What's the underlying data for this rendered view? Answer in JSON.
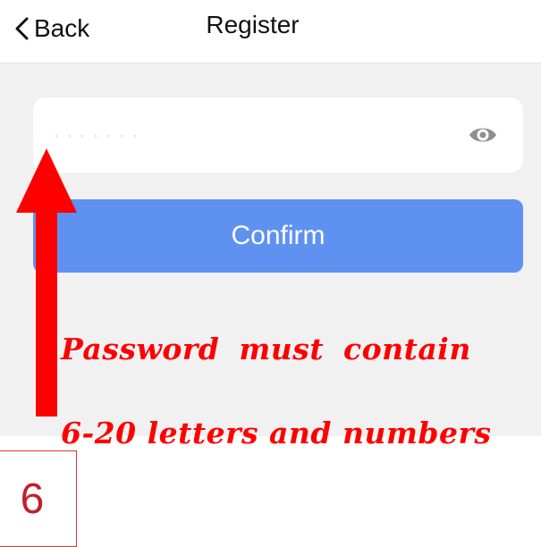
{
  "nav": {
    "back_label": "Back",
    "title": "Register"
  },
  "form": {
    "password_value": "",
    "password_placeholder": "· · · · · · ·",
    "confirm_label": "Confirm"
  },
  "annotation": {
    "hint_line1": "Password must contain",
    "hint_line2": "6-20 letters and numbers",
    "step_number": "6"
  },
  "icons": {
    "back": "chevron-left-icon",
    "visibility": "eye-icon",
    "arrow": "up-arrow-icon"
  },
  "colors": {
    "accent": "#5f92f0",
    "annotation": "#ff0000",
    "background": "#f1f1f1"
  }
}
